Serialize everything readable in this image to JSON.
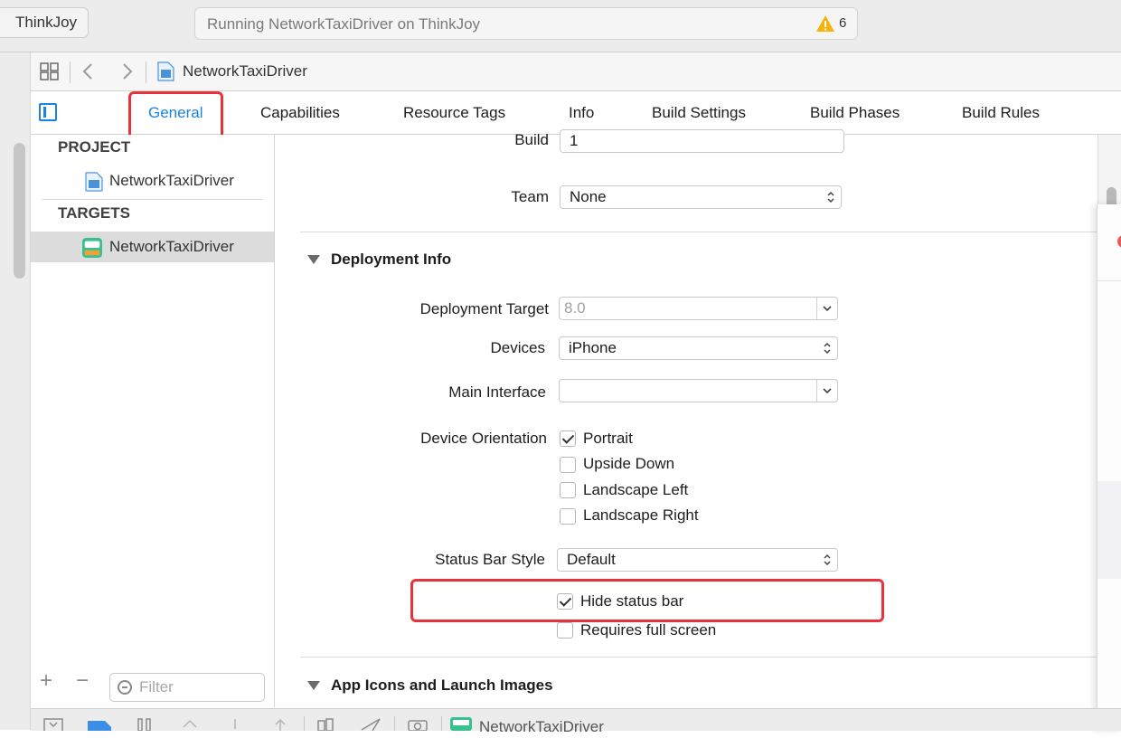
{
  "toolbar": {
    "scheme_label": "ThinkJoy",
    "activity_text": "Running NetworkTaxiDriver on ThinkJoy",
    "warning_count": "6"
  },
  "jumpbar": {
    "label": "NetworkTaxiDriver"
  },
  "tabs": [
    {
      "label": "General"
    },
    {
      "label": "Capabilities"
    },
    {
      "label": "Resource Tags"
    },
    {
      "label": "Info"
    },
    {
      "label": "Build Settings"
    },
    {
      "label": "Build Phases"
    },
    {
      "label": "Build Rules"
    }
  ],
  "navigator": {
    "project_header": "PROJECT",
    "project_item": "NetworkTaxiDriver",
    "targets_header": "TARGETS",
    "target_item": "NetworkTaxiDriver",
    "filter_placeholder": "Filter"
  },
  "identity": {
    "build_label": "Build",
    "build_value": "1",
    "team_label": "Team",
    "team_value": "None"
  },
  "deployment": {
    "section_title": "Deployment Info",
    "target_label": "Deployment Target",
    "target_value": "8.0",
    "devices_label": "Devices",
    "devices_value": "iPhone",
    "main_interface_label": "Main Interface",
    "main_interface_value": "",
    "orientation_label": "Device Orientation",
    "orientations": [
      {
        "label": "Portrait",
        "checked": true
      },
      {
        "label": "Upside Down",
        "checked": false
      },
      {
        "label": "Landscape Left",
        "checked": false
      },
      {
        "label": "Landscape Right",
        "checked": false
      }
    ],
    "status_bar_label": "Status Bar Style",
    "status_bar_value": "Default",
    "hide_status_bar": {
      "label": "Hide status bar",
      "checked": true
    },
    "requires_full_screen": {
      "label": "Requires full screen",
      "checked": false
    }
  },
  "app_icons": {
    "section_title": "App Icons and Launch Images"
  },
  "debugbar": {
    "label": "NetworkTaxiDriver"
  },
  "colors": {
    "accent": "#1a82e2",
    "highlight_box": "#e8333c",
    "warning": "#f5b30c"
  }
}
